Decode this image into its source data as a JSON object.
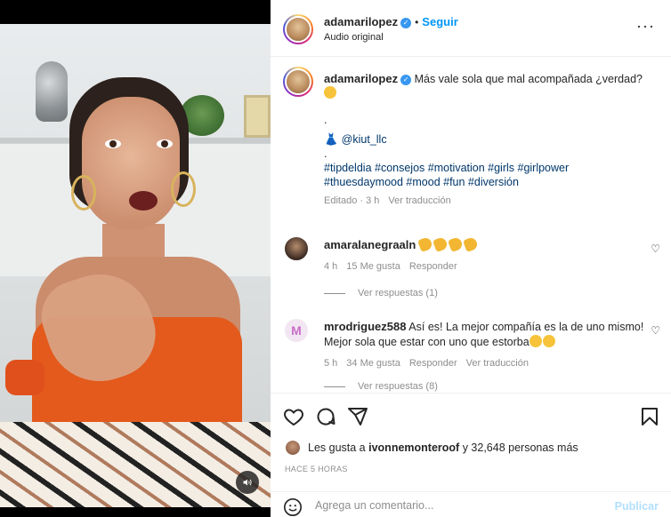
{
  "post": {
    "username": "adamarilopez",
    "follow_label": "Seguir",
    "dot": "•",
    "audio": "Audio original",
    "more": "···"
  },
  "caption": {
    "username": "adamarilopez",
    "text": "Más vale sola que mal acompañada ¿verdad?",
    "dot1": ".",
    "mention": "@kiut_llc",
    "dot2": ".",
    "hashtags_line1": "#tipdeldia #consejos #motivation #girls #girlpower",
    "hashtags_line2": "#thuesdaymood #mood #fun #diversión",
    "edited": "Editado · 3 h",
    "translate": "Ver traducción"
  },
  "comments": [
    {
      "username": "amaralanegraaln",
      "time": "4 h",
      "likes": "15 Me gusta",
      "reply": "Responder",
      "view_replies": "Ver respuestas (1)"
    },
    {
      "username": "mrodriguez588",
      "text_line1": "Así es! La mejor compañía es la de uno mismo!",
      "text_line2": "Mejor sola que estar con uno que estorba",
      "time": "5 h",
      "likes": "34 Me gusta",
      "reply": "Responder",
      "translate": "Ver traducción",
      "view_replies": "Ver respuestas (8)"
    }
  ],
  "likes": {
    "prefix": "Les gusta a",
    "user": "ivonnemonteroof",
    "suffix": "y 32,648 personas más"
  },
  "time_ago": "HACE 5 HORAS",
  "add_comment": {
    "placeholder": "Agrega un comentario...",
    "publish": "Publicar"
  },
  "colors": {
    "link": "#0095f6",
    "hashtag": "#00376b",
    "muted": "#8e8e8e",
    "publish_disabled": "#b2dffc",
    "top_orange": "#e35a1c"
  },
  "icons": [
    "more-icon",
    "heart-icon",
    "comment-icon",
    "share-icon",
    "bookmark-icon",
    "emoji-icon",
    "volume-icon",
    "verified-icon"
  ]
}
